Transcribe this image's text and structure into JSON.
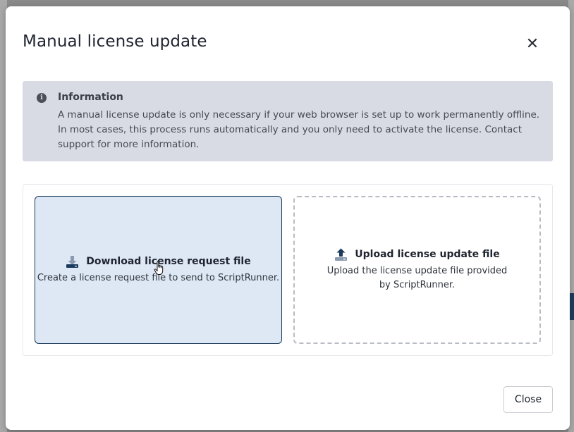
{
  "dialog": {
    "title": "Manual license update",
    "close_icon": "close-icon",
    "close_button_label": "Close"
  },
  "info": {
    "icon": "info-circle-icon",
    "title": "Information",
    "text": "A manual license update is only necessary if your web browser is set up to work permanently offline. In most cases, this process runs automatically and you only need to activate the license. Contact support for more information."
  },
  "options": {
    "download": {
      "icon": "download-icon",
      "title": "Download license request file",
      "description": "Create a license request file to send to ScriptRunner.",
      "selected": true
    },
    "upload": {
      "icon": "upload-icon",
      "title": "Upload license update file",
      "description": "Upload the license update file provided by ScriptRunner."
    }
  },
  "colors": {
    "selected_card_bg": "#dde8f4",
    "selected_card_border": "#1a3a5c",
    "info_bg": "#d8dbe3",
    "icon_navy": "#1a3a5c"
  }
}
